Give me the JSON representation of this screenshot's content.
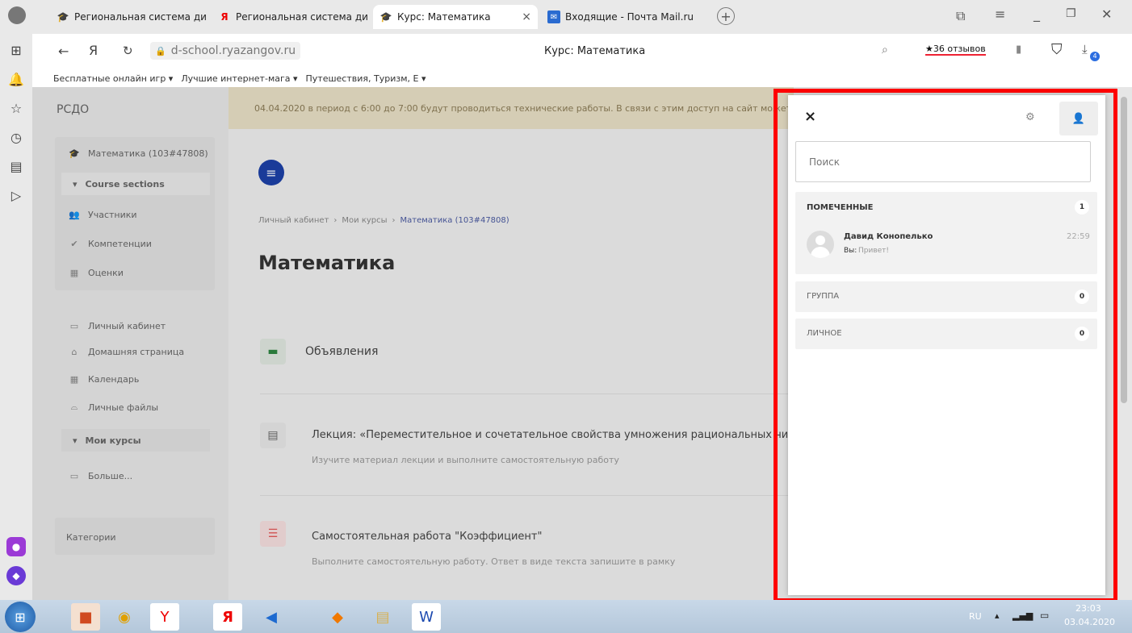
{
  "tabs": [
    {
      "title": "Региональная система ди",
      "icon": "moodle-icon"
    },
    {
      "title": "Региональная система ди",
      "icon": "yandex-icon"
    },
    {
      "title": "Курс: Математика",
      "icon": "moodle-icon",
      "close": "×"
    },
    {
      "title": "Входящие - Почта Mail.ru",
      "icon": "mail-icon"
    }
  ],
  "address": {
    "url": "d-school.ryazangov.ru",
    "page_title": "Курс: Математика",
    "reviews": "★36 отзывов",
    "download_badge": "4"
  },
  "bookmarks": [
    "Бесплатные онлайн игр ▾",
    "Лучшие интернет-мага ▾",
    "Путешествия, Туризм, Е ▾"
  ],
  "site": {
    "brand": "РСДО",
    "banner": "04.04.2020 в период с 6:00 до 7:00 будут проводиться технические работы. В связи с этим доступ на сайт может"
  },
  "nav": {
    "course": "Математика (103#47808)",
    "course_sections": "Course sections",
    "items": [
      "Участники",
      "Компетенции",
      "Оценки"
    ],
    "items2": [
      "Личный кабинет",
      "Домашняя страница",
      "Календарь",
      "Личные файлы"
    ],
    "my_courses": "Мои курсы",
    "more": "Больше...",
    "categories": "Категории"
  },
  "breadcrumb": {
    "a": "Личный кабинет",
    "sep1": "›",
    "b": "Мои курсы",
    "sep2": "›",
    "c": "Математика (103#47808)"
  },
  "course": {
    "title": "Математика"
  },
  "activities": [
    {
      "title": "Объявления",
      "desc": ""
    },
    {
      "title": "Лекция: «Переместительное и сочетательное свойства умножения рациональных чисе",
      "desc": "Изучите материал лекции и выполните самостоятельную работу"
    },
    {
      "title": "Самостоятельная работа \"Коэффициент\"",
      "desc": "Выполните самостоятельную работу. Ответ в виде текста запишите в рамку"
    }
  ],
  "messages": {
    "close": "×",
    "search_placeholder": "Поиск",
    "starred": {
      "label": "ПОМЕЧЕННЫЕ",
      "count": "1"
    },
    "contact": {
      "name": "Давид Конопелько",
      "you": "Вы:",
      "preview": "Привет!",
      "time": "22:59"
    },
    "group": {
      "label": "ГРУППА",
      "count": "0"
    },
    "personal": {
      "label": "ЛИЧНОЕ",
      "count": "0"
    }
  },
  "taskbar": {
    "lang": "RU",
    "time": "23:03",
    "date": "03.04.2020"
  },
  "colors": {
    "highlight": "#ff0000",
    "accent": "#1d40a6",
    "announce": "#2e8540",
    "quiz": "#e35a5a"
  }
}
